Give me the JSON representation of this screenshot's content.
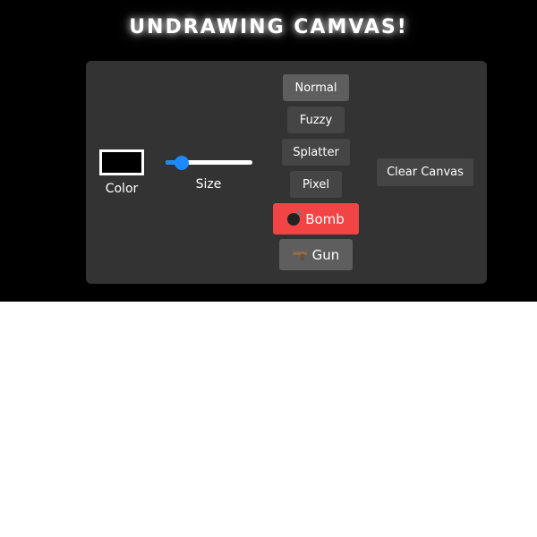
{
  "header": {
    "title": "UNDRAWING CAMVAS!"
  },
  "controls": {
    "color_label": "Color",
    "size_label": "Size",
    "color_value": "#000000",
    "size_fraction": 0.12
  },
  "brushes": {
    "normal": "Normal",
    "fuzzy": "Fuzzy",
    "splatter": "Splatter",
    "pixel": "Pixel",
    "bomb": "Bomb",
    "gun": "Gun"
  },
  "actions": {
    "clear": "Clear Canvas"
  },
  "colors": {
    "accent": "#1e88ff",
    "bomb_bg": "#f24444",
    "panel_bg": "#333333",
    "button_bg": "#454545",
    "button_active_bg": "#5e5e5e"
  },
  "icons": {
    "bomb": "bomb-icon",
    "gun": "gun-icon"
  }
}
